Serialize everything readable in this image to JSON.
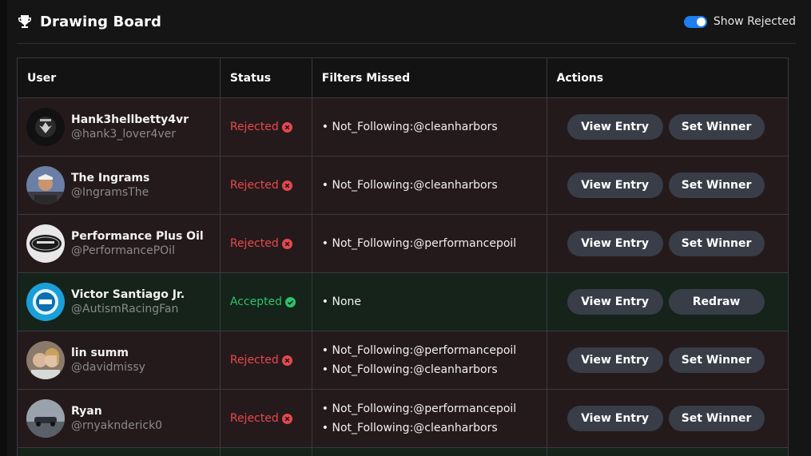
{
  "header": {
    "title": "Drawing Board",
    "toggle_label": "Show Rejected",
    "toggle_on": true
  },
  "table": {
    "columns": [
      "User",
      "Status",
      "Filters Missed",
      "Actions"
    ],
    "rows": [
      {
        "name": "Hank3hellbetty4vr",
        "handle": "@hank3_lover4ver",
        "status": "Rejected",
        "filters": [
          "• Not_Following:@cleanharbors"
        ],
        "actions": [
          "View Entry",
          "Set Winner"
        ]
      },
      {
        "name": "The Ingrams",
        "handle": "@IngramsThe",
        "status": "Rejected",
        "filters": [
          "• Not_Following:@cleanharbors"
        ],
        "actions": [
          "View Entry",
          "Set Winner"
        ]
      },
      {
        "name": "Performance Plus Oil",
        "handle": "@PerformancePOil",
        "status": "Rejected",
        "filters": [
          "• Not_Following:@performancepoil"
        ],
        "actions": [
          "View Entry",
          "Set Winner"
        ]
      },
      {
        "name": "Victor Santiago Jr.",
        "handle": "@AutismRacingFan",
        "status": "Accepted",
        "filters": [
          "• None"
        ],
        "actions": [
          "View Entry",
          "Redraw"
        ]
      },
      {
        "name": "lin summ",
        "handle": "@davidmissy",
        "status": "Rejected",
        "filters": [
          "• Not_Following:@performancepoil",
          "• Not_Following:@cleanharbors"
        ],
        "actions": [
          "View Entry",
          "Set Winner"
        ]
      },
      {
        "name": "Ryan",
        "handle": "@rnyaknderick0",
        "status": "Rejected",
        "filters": [
          "• Not_Following:@performancepoil",
          "• Not_Following:@cleanharbors"
        ],
        "actions": [
          "View Entry",
          "Set Winner"
        ]
      }
    ]
  },
  "colors": {
    "accent": "#1e7ff0",
    "rejected": "#e5484d",
    "accepted": "#2ec26a",
    "rejected_row": "#251a1b",
    "accepted_row": "#15231a"
  }
}
